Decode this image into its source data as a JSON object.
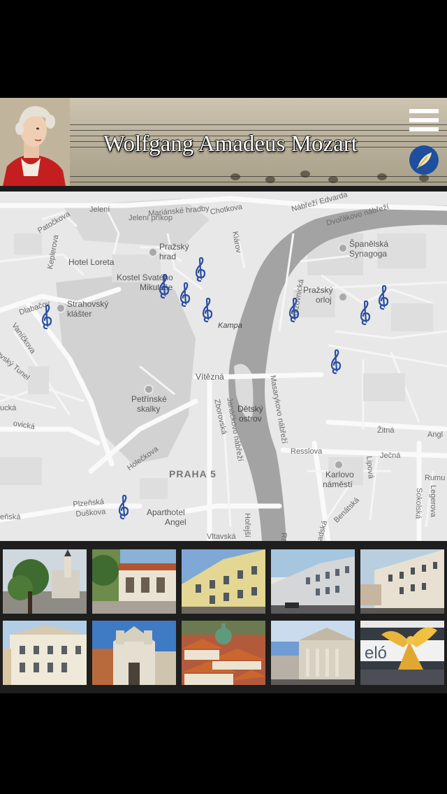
{
  "header": {
    "title": "Wolfgang Amadeus Mozart",
    "menu_icon": "hamburger-menu-icon",
    "quill_icon": "quill-icon",
    "accent_color": "#1d4f9e"
  },
  "map": {
    "labels": {
      "patockova": "Patočkova",
      "jeleni": "Jelení",
      "marianske_hradby": "Mariánské hradby",
      "chotkova": "Chotkova",
      "nabrezi_edvarda": "Nábřeží Edvarda",
      "dvorakovo_nabrezi": "Dvořákovo nábřeží",
      "jeleni_prikop": "Jelení příkop",
      "klarov": "Klárov",
      "keplerova": "Keplerova",
      "hotel_loreta": "Hotel Loreta",
      "prazsky_hrad_1": "Pražský",
      "prazsky_hrad_2": "hrad",
      "spanelska_1": "Španělská",
      "spanelska_2": "Synagoga",
      "kostel_1": "Kostel Svatého",
      "kostel_2": "Mikuláše",
      "krizovnicka": "Křižovnická",
      "prazsky_orloj_1": "Pražský",
      "prazsky_orloj_2": "orloj",
      "dlabacov": "Dlabačov",
      "strahov_1": "Strahovský",
      "strahov_2": "klášter",
      "vanickova": "Vaníčkova",
      "kampa": "Kampa",
      "tunel": "ovský Tunel",
      "vitezna": "Vítězná",
      "masarykovo": "Masarykovo nábřeží",
      "janackovo": "Janáčkovo nábřeží",
      "zborovska": "Zborovská",
      "petrinske_1": "Petřínské",
      "petrinske_2": "skalky",
      "detsky_1": "Dětský",
      "detsky_2": "ostrov",
      "zitna": "Žitná",
      "angl": "Angl",
      "ucka": "ucká",
      "ovicka": "ovická",
      "holeckova": "Holečkova",
      "resslova": "Resslova",
      "jecna": "Ječná",
      "praha5": "PRAHA 5",
      "karlovo_1": "Karlovo",
      "karlovo_2": "náměstí",
      "lipova": "Lipová",
      "rumu": "Rumu",
      "legerova": "Legerova",
      "sokolska": "Sokolská",
      "benatska": "Benátská",
      "adska": "adská",
      "plzenska": "Plzeňská",
      "duskova": "Duškova",
      "enska": "eňská",
      "aparthotel_1": "Aparthotel",
      "aparthotel_2": "Angel",
      "vltavska": "Vltavská",
      "horejsi": "Hořejší",
      "ra": "Ra"
    },
    "marker_icon": "treble-clef-icon",
    "marker_color": "#2a4fa0"
  },
  "gallery": {
    "items": [
      "Tree and church towers",
      "Garden terrace with arches",
      "Yellow palace facade",
      "White building with cars",
      "Palace on a corner",
      "White house facade",
      "Church with twin towers",
      "Red rooftops and green dome",
      "Estates Theatre",
      "Golden angel sculpture"
    ],
    "angel_sign": "eló"
  }
}
